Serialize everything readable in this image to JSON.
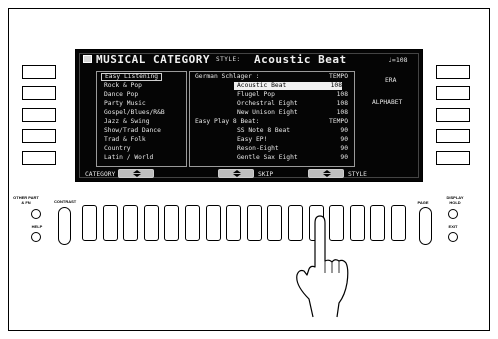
{
  "header": {
    "title": "MUSICAL CATEGORY",
    "style_label": "STYLE:",
    "style_name": "Acoustic Beat",
    "tempo": "♩=108"
  },
  "categories": [
    "Easy Listening",
    "Rock & Pop",
    "Dance Pop",
    "Party Music",
    "Gospel/Blues/R&B",
    "Jazz & Swing",
    "Show/Trad Dance",
    "Trad & Folk",
    "Country",
    "Latin / World"
  ],
  "selected_category": "Easy Listening",
  "styles": {
    "groups": [
      {
        "label": "German Schlager :",
        "tempo_header": "TEMPO",
        "items": [
          {
            "name": "Acoustic Beat",
            "tempo": "108",
            "selected": true
          },
          {
            "name": "Flugel Pop",
            "tempo": "108"
          },
          {
            "name": "Orchestral Eight",
            "tempo": "108"
          },
          {
            "name": "New Unison Eight",
            "tempo": "108"
          }
        ]
      },
      {
        "label": "Easy Play 8 Beat:",
        "tempo_header": "TEMPO",
        "items": [
          {
            "name": "SS Note 8 Beat",
            "tempo": "90"
          },
          {
            "name": "Easy EP!",
            "tempo": "90"
          },
          {
            "name": "Reson-Eight",
            "tempo": "90"
          },
          {
            "name": "Gentle Sax Eight",
            "tempo": "90"
          }
        ]
      }
    ]
  },
  "right_options": {
    "era": "ERA",
    "alphabet": "ALPHABET"
  },
  "bottom_labels": {
    "category": "CATEGORY",
    "skip": "SKIP",
    "style": "STYLE"
  },
  "panel_labels": {
    "other_part_fn": "OTHER PART & FN",
    "help": "HELP",
    "contrast": "CONTRAST",
    "page": "PAGE",
    "display_hold": "DISPLAY HOLD",
    "exit": "EXIT"
  },
  "number_button_count": 16
}
